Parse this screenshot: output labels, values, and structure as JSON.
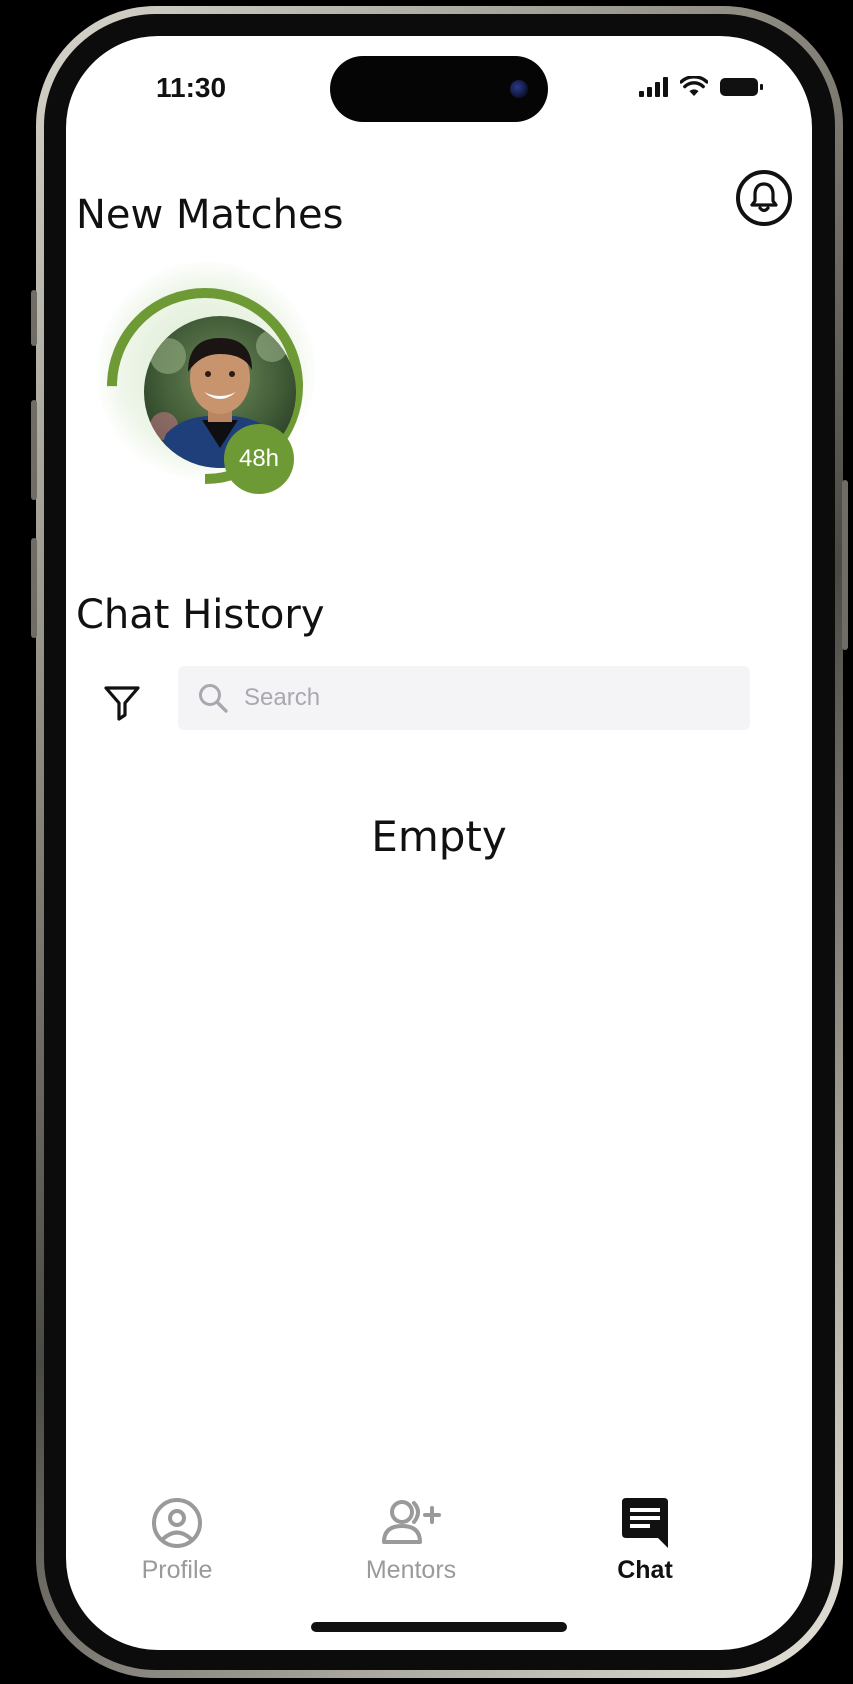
{
  "status_bar": {
    "time": "11:30"
  },
  "notifications": {
    "icon": "bell-icon"
  },
  "new_matches": {
    "title": "New Matches",
    "items": [
      {
        "timer": "48h",
        "ring_color": "#6e9a36",
        "ring_progress": 0.75
      }
    ]
  },
  "chat_history": {
    "title": "Chat History",
    "filter_icon": "filter-icon",
    "search": {
      "placeholder": "Search",
      "value": ""
    },
    "empty_text": "Empty"
  },
  "tab_bar": {
    "tabs": [
      {
        "label": "Profile",
        "icon": "profile-icon",
        "active": false
      },
      {
        "label": "Mentors",
        "icon": "mentors-icon",
        "active": false
      },
      {
        "label": "Chat",
        "icon": "chat-icon",
        "active": true
      }
    ]
  },
  "colors": {
    "accent_green": "#6e9a36",
    "search_bg": "#f4f4f7",
    "inactive_tab": "#9a9a9a",
    "active_tab": "#111111"
  }
}
